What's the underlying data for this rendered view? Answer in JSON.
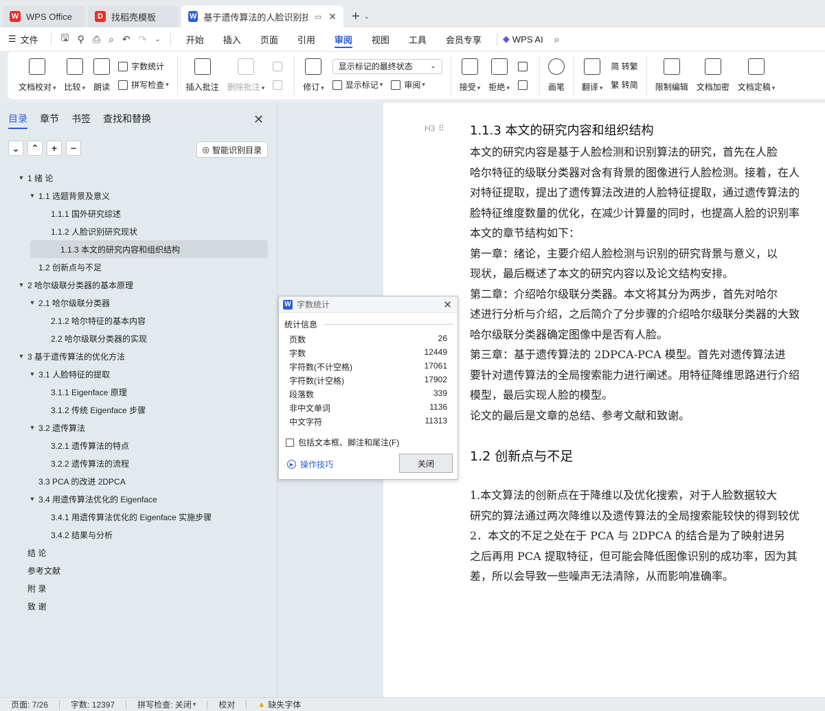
{
  "tabs": [
    {
      "label": "WPS Office",
      "icon": "wps-logo-icon",
      "color": "#e0312a"
    },
    {
      "label": "找稻壳模板",
      "icon": "docer-logo-icon",
      "color": "#e0312a"
    },
    {
      "label": "基于遗传算法的人脸识别技术",
      "icon": "wps-writer-icon",
      "color": "#2b5fd9"
    }
  ],
  "menu": {
    "file": "文件",
    "tabs": [
      "开始",
      "插入",
      "页面",
      "引用",
      "审阅",
      "视图",
      "工具",
      "会员专享"
    ],
    "active_tab": "审阅",
    "ai": "WPS AI"
  },
  "ribbon": {
    "doc_check": "文档校对",
    "compare": "比较",
    "read_aloud": "朗读",
    "word_count": "字数统计",
    "spell_check": "拼写检查",
    "insert_comment": "插入批注",
    "delete_comment": "删除批注",
    "track": "修订",
    "markup_state": "显示标记的最终状态",
    "show_markup": "显示标记",
    "review": "审阅",
    "accept": "接受",
    "reject": "拒绝",
    "pen": "画笔",
    "translate": "翻译",
    "to_traditional": "简 转繁",
    "to_simplified": "繁 转简",
    "restrict_edit": "限制编辑",
    "encrypt": "文档加密",
    "finalize": "文档定稿"
  },
  "nav": {
    "tabs": [
      "目录",
      "章节",
      "书签",
      "查找和替换"
    ],
    "active_tab": "目录",
    "smart_toc": "智能识别目录",
    "toc": [
      {
        "label": "1  绪  论",
        "level": 0,
        "toggle": "▼"
      },
      {
        "label": "1.1  选题背景及意义",
        "level": 1,
        "toggle": "▼"
      },
      {
        "label": "1.1.1  国外研究综述",
        "level": 2,
        "toggle": ""
      },
      {
        "label": "1.1.2  人脸识别研究现状",
        "level": 2,
        "toggle": ""
      },
      {
        "label": "1.1.3 本文的研究内容和组织结构",
        "level": 2,
        "toggle": "",
        "selected": true
      },
      {
        "label": "1.2  创新点与不足",
        "level": 1,
        "toggle": ""
      },
      {
        "label": "2 哈尔级联分类器的基本原理",
        "level": 0,
        "toggle": "▼"
      },
      {
        "label": "2.1 哈尔级联分类器",
        "level": 1,
        "toggle": "▼"
      },
      {
        "label": "2.1.2 哈尔特征的基本内容",
        "level": 2,
        "toggle": ""
      },
      {
        "label": "2.2  哈尔级联分类器的实现",
        "level": 2,
        "toggle": ""
      },
      {
        "label": "3 基于遗传算法的优化方法",
        "level": 0,
        "toggle": "▼"
      },
      {
        "label": "3.1 人脸特征的提取",
        "level": 1,
        "toggle": "▼"
      },
      {
        "label": "3.1.1 Eigenface 原理",
        "level": 2,
        "toggle": ""
      },
      {
        "label": "3.1.2 传统 Eigenface 步骤",
        "level": 2,
        "toggle": ""
      },
      {
        "label": "3.2  遗传算法",
        "level": 1,
        "toggle": "▼"
      },
      {
        "label": "3.2.1 遗传算法的特点",
        "level": 2,
        "toggle": ""
      },
      {
        "label": "3.2.2  遗传算法的流程",
        "level": 2,
        "toggle": ""
      },
      {
        "label": "3.3 PCA 的改进 2DPCA",
        "level": 1,
        "toggle": ""
      },
      {
        "label": "3.4  用遗传算法优化的 Eigenface",
        "level": 1,
        "toggle": "▼"
      },
      {
        "label": "3.4.1 用遗传算法优化的 Eigenface 实施步骤",
        "level": 2,
        "toggle": ""
      },
      {
        "label": "3.4.2  结果与分析",
        "level": 2,
        "toggle": ""
      },
      {
        "label": "结  论",
        "level": 0,
        "toggle": ""
      },
      {
        "label": "参考文献",
        "level": 0,
        "toggle": ""
      },
      {
        "label": "附  录",
        "level": 0,
        "toggle": ""
      },
      {
        "label": "致  谢",
        "level": 0,
        "toggle": ""
      }
    ]
  },
  "document": {
    "heading_mark": "H3",
    "heading": "1.1.3 本文的研究内容和组织结构",
    "paragraphs": [
      "      本文的研究内容是基于人脸检测和识别算法的研究，首先在人脸",
      "哈尔特征的级联分类器对含有背景的图像进行人脸检测。接着，在人",
      "对特征提取，提出了遗传算法改进的人脸特征提取，通过遗传算法的",
      "脸特征维度数量的优化，在减少计算量的同时，也提高人脸的识别率",
      "      本文的章节结构如下：",
      "      第一章：绪论，主要介绍人脸检测与识别的研究背景与意义，以",
      "现状，最后概述了本文的研究内容以及论文结构安排。",
      "      第二章：介绍哈尔级联分类器。本文将其分为两步，首先对哈尔",
      "述进行分析与介绍，之后简介了分步骤的介绍哈尔级联分类器的大致",
      "哈尔级联分类器确定图像中是否有人脸。",
      "      第三章：基于遗传算法的 2DPCA-PCA 模型。首先对遗传算法进",
      "要针对遗传算法的全局搜索能力进行阐述。用特征降维思路进行介绍",
      "模型，最后实现人脸的模型。",
      "      论文的最后是文章的总结、参考文献和致谢。"
    ],
    "heading2": "1.2  创新点与不足",
    "paragraphs2": [
      "      1.本文算法的创新点在于降维以及优化搜索，对于人脸数据较大",
      "研究的算法通过两次降维以及遗传算法的全局搜索能较快的得到较优",
      "      2．本文的不足之处在于 PCA 与 2DPCA 的结合是为了映射进另",
      "之后再用 PCA 提取特征，但可能会降低图像识别的成功率，因为其",
      "差，所以会导致一些噪声无法清除，从而影响准确率。"
    ]
  },
  "dialog": {
    "title": "字数统计",
    "section": "统计信息",
    "rows": [
      {
        "label": "页数",
        "value": "26"
      },
      {
        "label": "字数",
        "value": "12449"
      },
      {
        "label": "字符数(不计空格)",
        "value": "17061"
      },
      {
        "label": "字符数(计空格)",
        "value": "17902"
      },
      {
        "label": "段落数",
        "value": "339"
      },
      {
        "label": "非中文单词",
        "value": "1136"
      },
      {
        "label": "中文字符",
        "value": "11313"
      }
    ],
    "include_label": "包括文本框、脚注和尾注(F)",
    "tips": "操作技巧",
    "close": "关闭"
  },
  "status": {
    "page": "页面: 7/26",
    "words": "字数: 12397",
    "spell": "拼写检查: 关闭",
    "proof": "校对",
    "missing_font": "缺失字体"
  },
  "colors": {
    "accent": "#2b5fd9",
    "brand_red": "#e0312a",
    "panel_bg": "#e3eaee"
  }
}
